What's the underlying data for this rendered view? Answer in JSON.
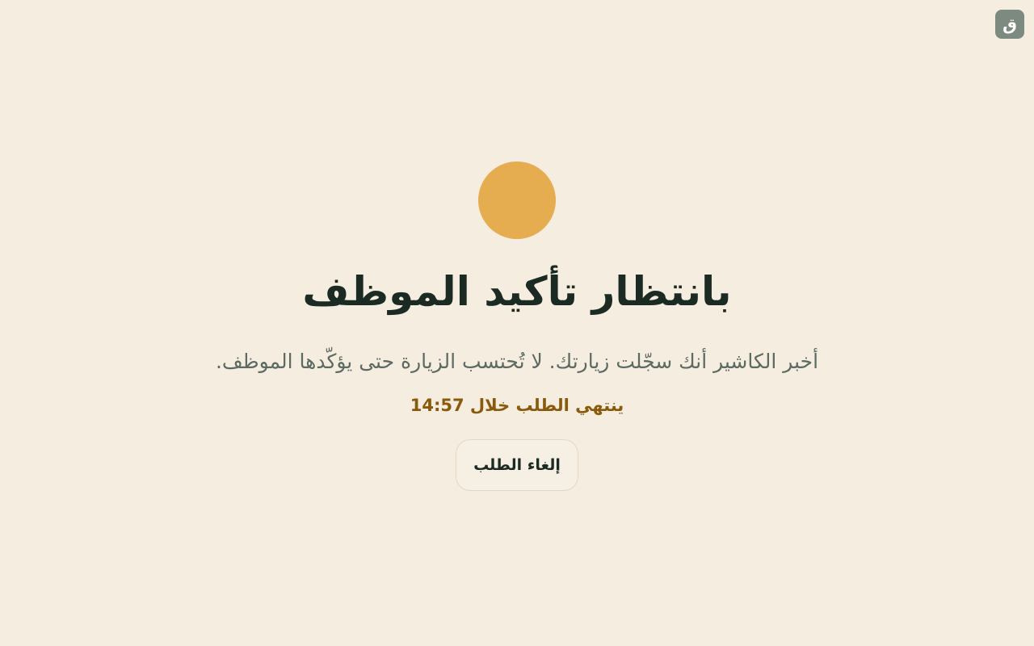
{
  "brand": {
    "badge_glyph": "ق",
    "badge_color": "#7d8a7f"
  },
  "status": {
    "indicator_color": "#e5ac50",
    "title": "بانتظار تأكيد الموظف",
    "message": "أخبر الكاشير أنك سجّلت زيارتك. لا تُحتسب الزيارة حتى يؤكّدها الموظف.",
    "countdown_label": "ينتهي الطلب خلال 14:57"
  },
  "actions": {
    "cancel_label": "إلغاء الطلب"
  },
  "colors": {
    "background": "#f5ede0",
    "title": "#1b2a22",
    "message": "#5c6a62",
    "countdown": "#8a5a0c"
  }
}
